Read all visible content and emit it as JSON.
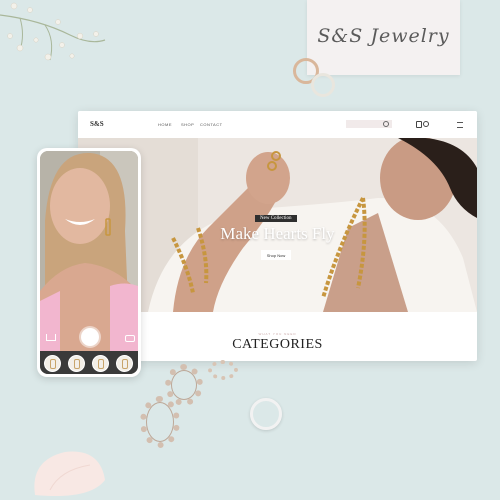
{
  "brand_card": {
    "text": "S&S Jewelry"
  },
  "website": {
    "logo": "S&S",
    "nav": {
      "home": "HOME",
      "shop": "SHOP",
      "contact": "CONTACT"
    },
    "hero": {
      "badge": "New Collection",
      "title": "Make Hearts Fly",
      "button": "Shop Now"
    },
    "categories": {
      "kicker": "WHAT YOU NEED",
      "title": "CATEGORIES"
    }
  },
  "phone_app": {
    "icons": [
      "cart-icon",
      "shutter-button",
      "camera-icon"
    ],
    "thumbnails": [
      "earring-thumb-1",
      "earring-thumb-2",
      "earring-thumb-3",
      "earring-thumb-4"
    ]
  },
  "colors": {
    "background": "#dbe8e8",
    "accent_pink": "#f2b6cf",
    "gold": "#c8a46a"
  }
}
